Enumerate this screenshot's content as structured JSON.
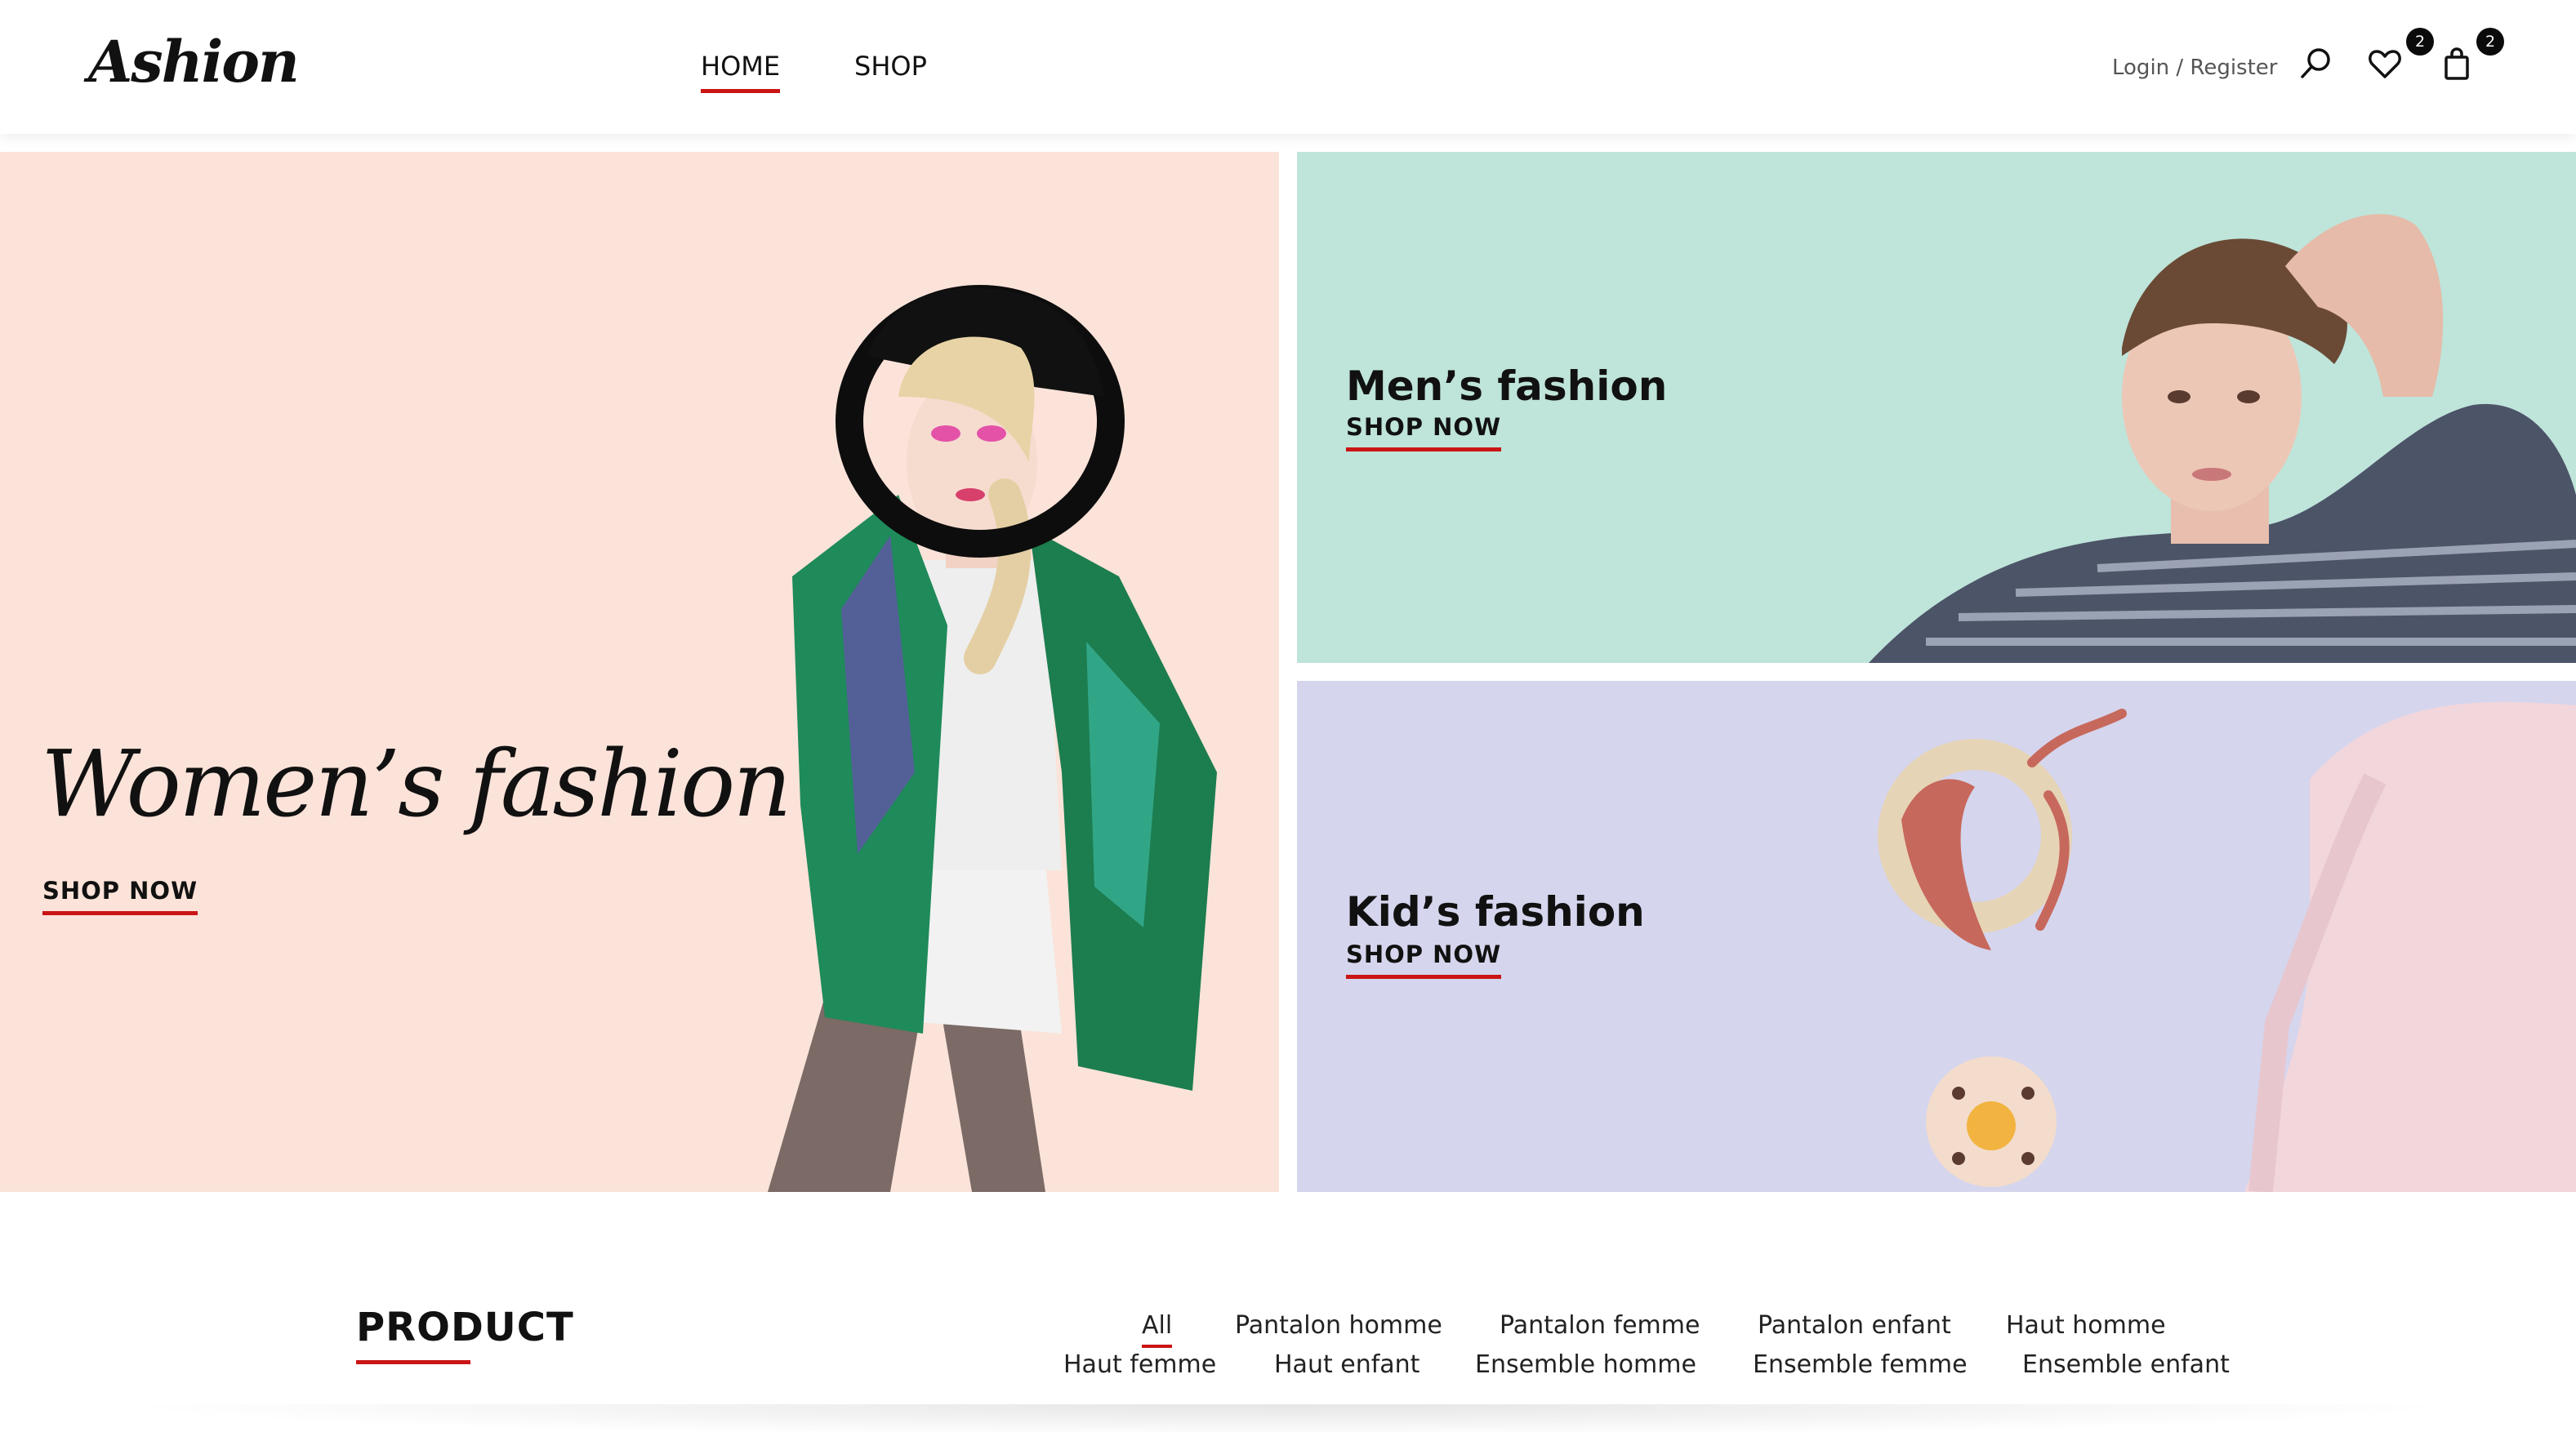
{
  "header": {
    "logo": "Ashion",
    "nav": [
      {
        "label": "HOME",
        "active": true
      },
      {
        "label": "SHOP",
        "active": false
      }
    ],
    "auth_text": "Login / Register",
    "icons": {
      "search": "search-icon",
      "wishlist": "heart-icon",
      "cart": "shopping-bag-icon"
    },
    "wishlist_count": "2",
    "cart_count": "2"
  },
  "banners": {
    "women": {
      "title": "Women’s fashion",
      "cta": "SHOP NOW",
      "bg": "#fbe3d9"
    },
    "men": {
      "title": "Men’s fashion",
      "cta": "SHOP NOW",
      "bg": "#bfe4da"
    },
    "kids": {
      "title": "Kid’s fashion",
      "cta": "SHOP NOW",
      "bg": "#d5d5ed"
    }
  },
  "product_section": {
    "title": "PRODUCT",
    "filters": [
      "All",
      "Pantalon homme",
      "Pantalon femme",
      "Pantalon enfant",
      "Haut homme",
      "Haut femme",
      "Haut enfant",
      "Ensemble homme",
      "Ensemble femme",
      "Ensemble enfant"
    ],
    "active_filter": "All"
  },
  "colors": {
    "accent": "#ca1515",
    "text": "#111111"
  }
}
